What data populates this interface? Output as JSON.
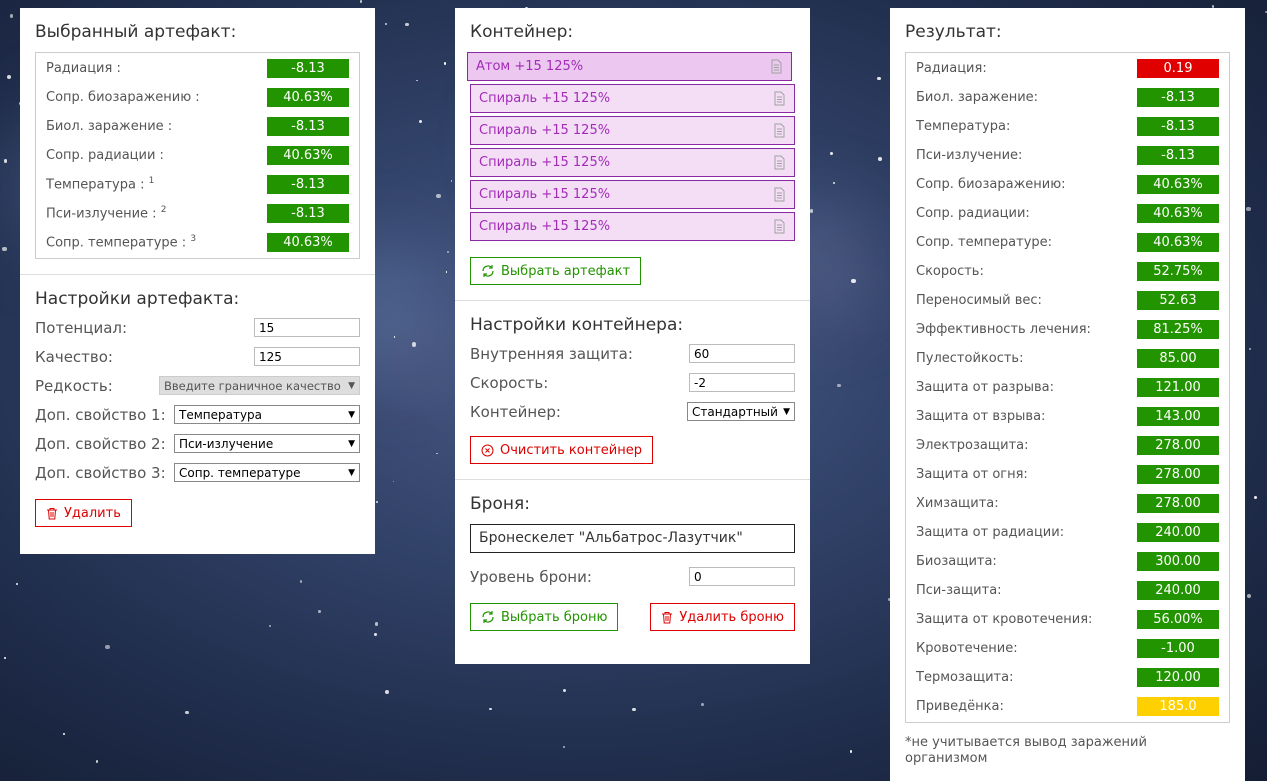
{
  "selected_artifact": {
    "title": "Выбранный артефакт:",
    "rows": [
      {
        "label": "Радиация :",
        "sup": "",
        "value": "-8.13"
      },
      {
        "label": "Сопр. биозаражению :",
        "sup": "",
        "value": "40.63%"
      },
      {
        "label": "Биол. заражение :",
        "sup": "",
        "value": "-8.13"
      },
      {
        "label": "Сопр. радиации :",
        "sup": "",
        "value": "40.63%"
      },
      {
        "label": "Температура :",
        "sup": "1",
        "value": "-8.13"
      },
      {
        "label": "Пси-излучение :",
        "sup": "2",
        "value": "-8.13"
      },
      {
        "label": "Сопр. температуре :",
        "sup": "3",
        "value": "40.63%"
      }
    ]
  },
  "artifact_settings": {
    "title": "Настройки артефакта:",
    "potential_label": "Потенциал:",
    "potential_value": "15",
    "quality_label": "Качество:",
    "quality_value": "125",
    "rarity_label": "Редкость:",
    "rarity_value": "Введите граничное качество",
    "extra1_label": "Доп. свойство 1:",
    "extra1_value": "Температура",
    "extra2_label": "Доп. свойство 2:",
    "extra2_value": "Пси-излучение",
    "extra3_label": "Доп. свойство 3:",
    "extra3_value": "Сопр. температуре",
    "delete_label": "Удалить"
  },
  "container": {
    "title": "Контейнер:",
    "items": [
      "Атом +15 125%",
      "Спираль +15 125%",
      "Спираль +15 125%",
      "Спираль +15 125%",
      "Спираль +15 125%",
      "Спираль +15 125%"
    ],
    "select_artifact_label": "Выбрать артефакт"
  },
  "container_settings": {
    "title": "Настройки контейнера:",
    "inner_protection_label": "Внутренняя защита:",
    "inner_protection_value": "60",
    "speed_label": "Скорость:",
    "speed_value": "-2",
    "container_label": "Контейнер:",
    "container_value": "Стандартный",
    "clear_label": "Очистить контейнер"
  },
  "armor": {
    "title": "Броня:",
    "name": "Бронескелет \"Альбатрос-Лазутчик\"",
    "level_label": "Уровень брони:",
    "level_value": "0",
    "select_label": "Выбрать броню",
    "delete_label": "Удалить броню"
  },
  "result": {
    "title": "Результат:",
    "rows": [
      {
        "label": "Радиация:",
        "value": "0.19",
        "color": "red"
      },
      {
        "label": "Биол. заражение:",
        "value": "-8.13",
        "color": "green"
      },
      {
        "label": "Температура:",
        "value": "-8.13",
        "color": "green"
      },
      {
        "label": "Пси-излучение:",
        "value": "-8.13",
        "color": "green"
      },
      {
        "label": "Сопр. биозаражению:",
        "value": "40.63%",
        "color": "green"
      },
      {
        "label": "Сопр. радиации:",
        "value": "40.63%",
        "color": "green"
      },
      {
        "label": "Сопр. температуре:",
        "value": "40.63%",
        "color": "green"
      },
      {
        "label": "Скорость:",
        "value": "52.75%",
        "color": "green"
      },
      {
        "label": "Переносимый вес:",
        "value": "52.63",
        "color": "green"
      },
      {
        "label": "Эффективность лечения:",
        "value": "81.25%",
        "color": "green"
      },
      {
        "label": "Пулестойкость:",
        "value": "85.00",
        "color": "green"
      },
      {
        "label": "Защита от разрыва:",
        "value": "121.00",
        "color": "green"
      },
      {
        "label": "Защита от взрыва:",
        "value": "143.00",
        "color": "green"
      },
      {
        "label": "Электрозащита:",
        "value": "278.00",
        "color": "green"
      },
      {
        "label": "Защита от огня:",
        "value": "278.00",
        "color": "green"
      },
      {
        "label": "Химзащита:",
        "value": "278.00",
        "color": "green"
      },
      {
        "label": "Защита от радиации:",
        "value": "240.00",
        "color": "green"
      },
      {
        "label": "Биозащита:",
        "value": "300.00",
        "color": "green"
      },
      {
        "label": "Пси-защита:",
        "value": "240.00",
        "color": "green"
      },
      {
        "label": "Защита от кровотечения:",
        "value": "56.00%",
        "color": "green"
      },
      {
        "label": "Кровотечение:",
        "value": "-1.00",
        "color": "green"
      },
      {
        "label": "Термозащита:",
        "value": "120.00",
        "color": "green"
      },
      {
        "label": "Приведёнка:",
        "value": "185.0",
        "color": "yellow"
      }
    ],
    "footnote": "*не учитывается вывод заражений организмом"
  },
  "colors": {
    "green": "#229400",
    "red": "#e00000",
    "yellow": "#ffd000",
    "purple": "#a32bb8"
  },
  "icons": {
    "copy": "document-icon",
    "refresh": "refresh-icon",
    "trash": "trash-icon",
    "clear": "clear-circle-icon"
  }
}
